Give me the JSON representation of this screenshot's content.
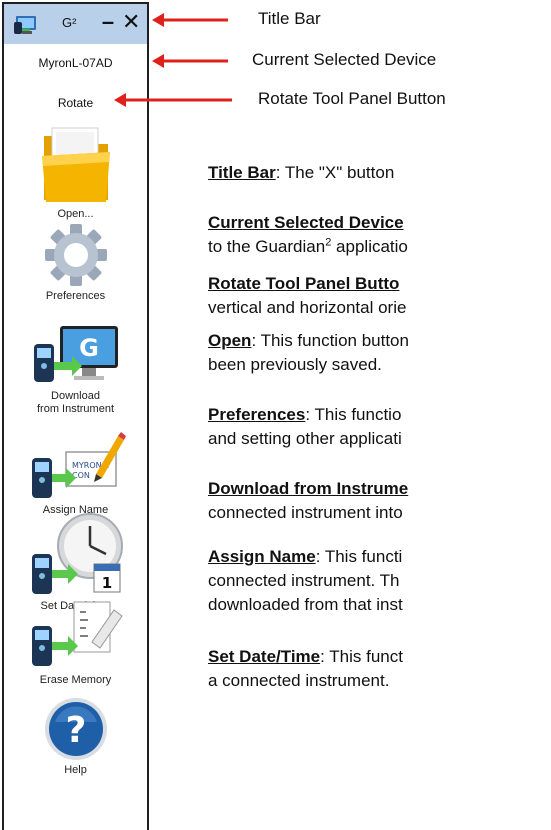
{
  "window": {
    "title": "G²",
    "minimize_label": "–",
    "close_label": "✕"
  },
  "device": {
    "name": "MyronL-07AD"
  },
  "rotate": {
    "label": "Rotate"
  },
  "tools": [
    {
      "label": "Open...",
      "icon": "folder-icon"
    },
    {
      "label": "Preferences",
      "icon": "gear-icon"
    },
    {
      "label_line1": "Download",
      "label_line2": "from Instrument",
      "icon": "download-instrument-icon"
    },
    {
      "label": "Assign Name",
      "icon": "assign-name-icon"
    },
    {
      "label": "Set Date/Time",
      "icon": "clock-calendar-icon"
    },
    {
      "label": "Erase Memory",
      "icon": "erase-memory-icon"
    },
    {
      "label": "Help",
      "icon": "help-icon"
    }
  ],
  "callouts": {
    "title_bar": "Title Bar",
    "current_device": "Current Selected Device",
    "rotate_button": "Rotate Tool Panel Button"
  },
  "descriptions": [
    {
      "term": "Title Bar",
      "line1": ":  The \"X\" button"
    },
    {
      "term": "Current Selected Device",
      "line2": "to the Guardian",
      "sup": "2",
      "line2_rest": " applicatio"
    },
    {
      "term": "Rotate Tool Panel Butto",
      "line2": "vertical and horizontal orie"
    },
    {
      "term": "Open",
      "line1": ": This function button",
      "line2": "been previously saved."
    },
    {
      "term": "Preferences",
      "line1": ":  This functio",
      "line2": "and setting other applicati"
    },
    {
      "term": "Download from Instrume",
      "line2": "connected instrument into"
    },
    {
      "term": "Assign Name",
      "line1": ": This functi",
      "line2": "connected instrument.   Th",
      "line3": "downloaded from that inst"
    },
    {
      "term": "Set Date/Time",
      "line1": ": This funct",
      "line2": "a connected instrument."
    }
  ],
  "colors": {
    "titlebar": "#b9d0ea",
    "arrow": "#e0201b",
    "folder": "#f5b400",
    "help": "#1e5fa8"
  }
}
